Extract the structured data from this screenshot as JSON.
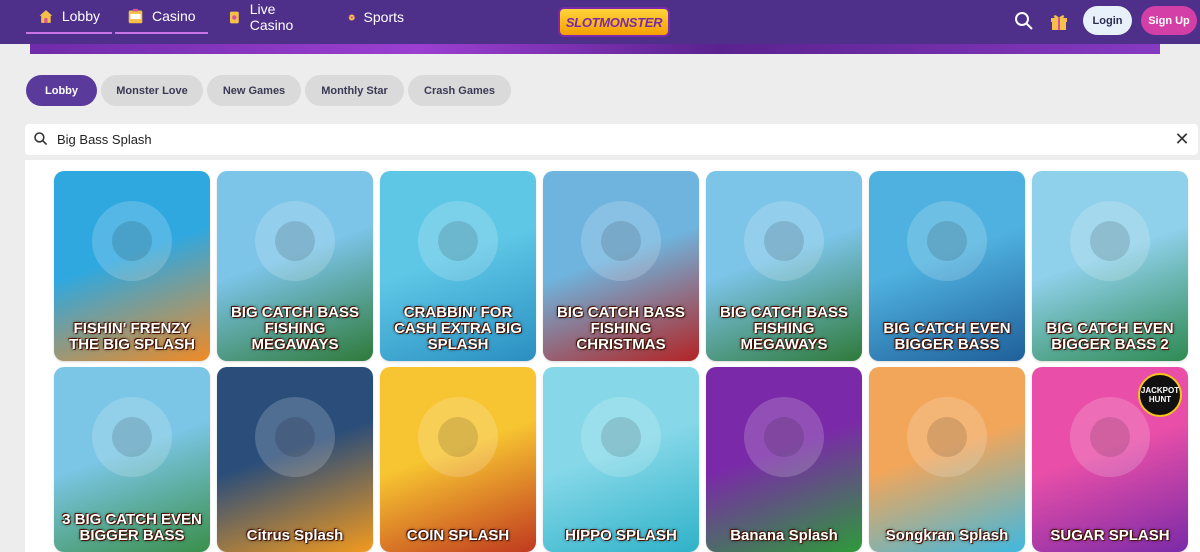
{
  "nav": {
    "items": [
      {
        "label": "Lobby",
        "icon": "home-icon",
        "color": "#f5c04a"
      },
      {
        "label": "Casino",
        "icon": "slot-machine-icon",
        "color": "#f5c04a"
      },
      {
        "label": "Live Casino",
        "icon": "cards-icon",
        "color": "#f5c04a"
      },
      {
        "label": "Sports",
        "icon": "soccer-ball-icon",
        "color": "#f5c04a"
      }
    ],
    "logo": "SLOTMONSTER",
    "login_label": "Login",
    "signup_label": "Sign Up"
  },
  "tabs": [
    {
      "label": "Lobby",
      "active": true
    },
    {
      "label": "Monster Love",
      "active": false
    },
    {
      "label": "New Games",
      "active": false
    },
    {
      "label": "Monthly Star",
      "active": false
    },
    {
      "label": "Crash Games",
      "active": false
    }
  ],
  "search": {
    "value": "Big Bass Splash"
  },
  "games": [
    {
      "title": "FISHIN' FRENZY THE BIG SPLASH",
      "bg": [
        "#2fa8e0",
        "#f08a24"
      ]
    },
    {
      "title": "BIG CATCH BASS FISHING MEGAWAYS",
      "bg": [
        "#7cc4e8",
        "#2f7a3a"
      ]
    },
    {
      "title": "CRABBIN' FOR CASH EXTRA BIG SPLASH",
      "bg": [
        "#5ec7e6",
        "#2a8fc1"
      ]
    },
    {
      "title": "BIG CATCH BASS FISHING CHRISTMAS",
      "bg": [
        "#6fb4de",
        "#b32424"
      ]
    },
    {
      "title": "BIG CATCH BASS FISHING MEGAWAYS",
      "bg": [
        "#7cc4e8",
        "#2f7a3a"
      ]
    },
    {
      "title": "BIG CATCH EVEN BIGGER BASS",
      "bg": [
        "#4fb1df",
        "#1f5f9a"
      ]
    },
    {
      "title": "BIG CATCH EVEN BIGGER BASS 2",
      "bg": [
        "#8fd0ea",
        "#2e8a52"
      ]
    },
    {
      "title": "3 BIG CATCH EVEN BIGGER BASS",
      "bg": [
        "#7bc6e6",
        "#3a8f4a"
      ]
    },
    {
      "title": "Citrus Splash",
      "bg": [
        "#2a4d7a",
        "#f29a1e"
      ]
    },
    {
      "title": "COIN SPLASH",
      "bg": [
        "#f7c531",
        "#c0391f"
      ]
    },
    {
      "title": "HIPPO SPLASH",
      "bg": [
        "#86d8e8",
        "#2fb2c9"
      ]
    },
    {
      "title": "Banana Splash",
      "bg": [
        "#7a2aa8",
        "#2e9a3a"
      ]
    },
    {
      "title": "Songkran Splash",
      "bg": [
        "#f2a65a",
        "#3fb8e0"
      ]
    },
    {
      "title": "SUGAR SPLASH",
      "bg": [
        "#e94fa8",
        "#7a2aa8"
      ],
      "badge": "JACKPOT HUNT"
    }
  ]
}
